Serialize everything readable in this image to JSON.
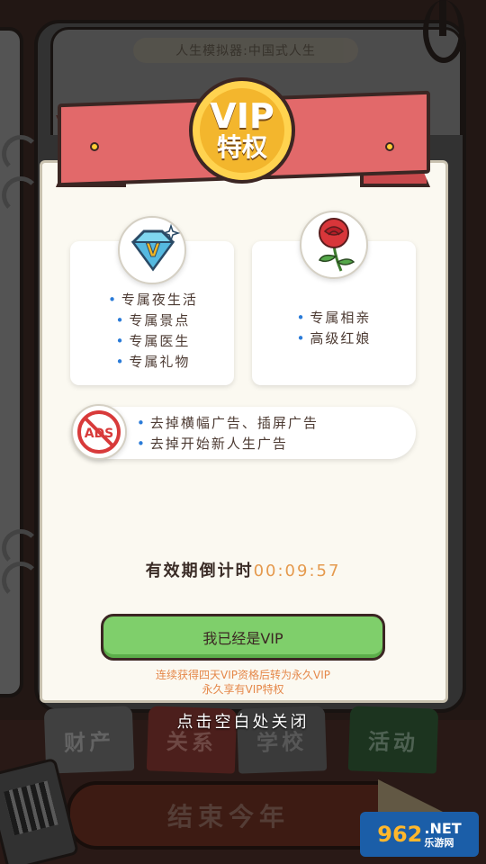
{
  "background": {
    "title": "人生模拟器:中国式人生",
    "tabs": [
      "财产",
      "关系",
      "学校",
      "活动"
    ],
    "end_year_button": "结束今年"
  },
  "dialog": {
    "badge": {
      "line1": "VIP",
      "line2": "特权"
    },
    "card_left_items": [
      "专属夜生活",
      "专属景点",
      "专属医生",
      "专属礼物"
    ],
    "card_right_items": [
      "专属相亲",
      "高级红娘"
    ],
    "ads_items": [
      "去掉横幅广告、插屏广告",
      "去掉开始新人生广告"
    ],
    "ads_icon_text": "ADS",
    "countdown_label": "有效期倒计时",
    "countdown_value": "00:09:57",
    "vip_button": "我已经是VIP",
    "note_line1": "连续获得四天VIP资格后转为永久VIP",
    "note_line2": "永久享有VIP特权",
    "close_hint": "点击空白处关闭"
  },
  "watermark": {
    "number": "962",
    "suffix": ".NET",
    "sub": "乐游网"
  },
  "colors": {
    "ribbon": "#e2696a",
    "coin": "#f3b62d",
    "button": "#7fcf6b",
    "countdown": "#e59a4e",
    "bullet": "#2a7bd8"
  },
  "icons": [
    "diamond-icon",
    "rose-icon",
    "no-ads-icon"
  ]
}
